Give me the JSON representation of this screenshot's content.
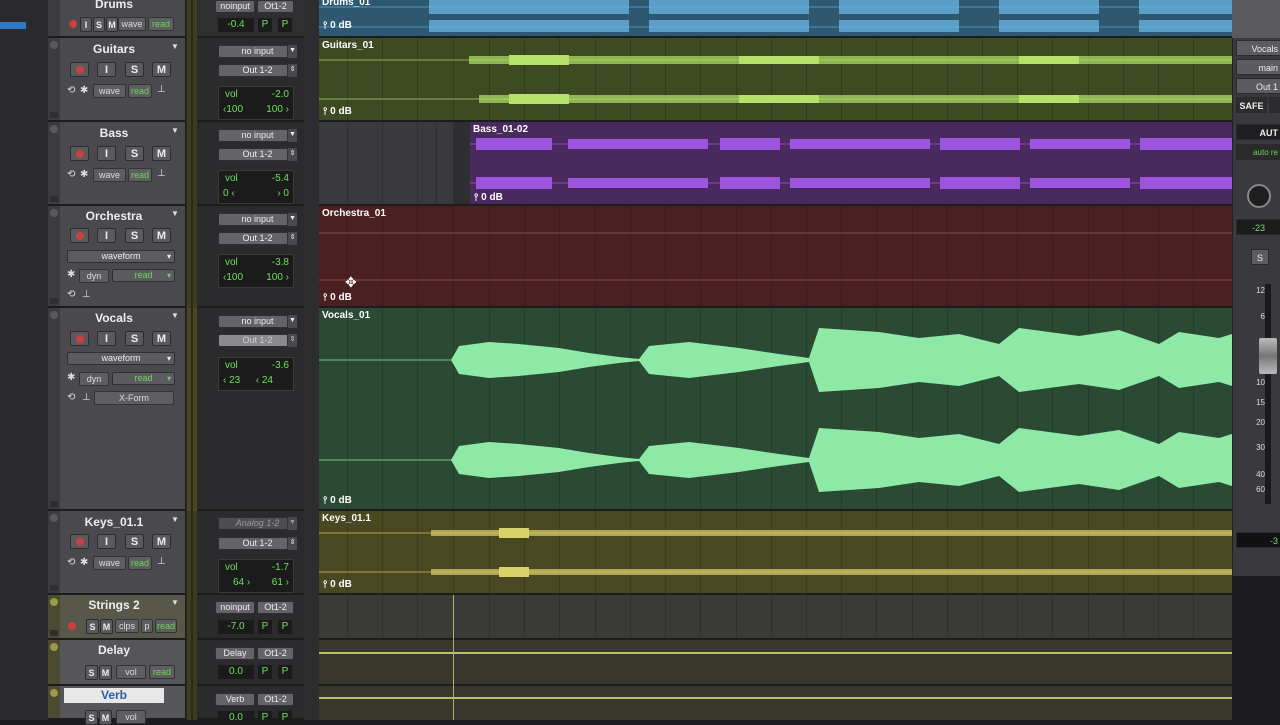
{
  "tracks": {
    "drums": {
      "name": "Drums",
      "input": "noinput",
      "output": "Ot1-2",
      "vol": "-0.4",
      "p1": "P",
      "p2": "P",
      "clip": "Drums_01",
      "gain": "0 dB",
      "view": "wave",
      "auto": "read"
    },
    "guitars": {
      "name": "Guitars",
      "input": "no input",
      "output": "Out 1-2",
      "vol_label": "vol",
      "vol": "-2.0",
      "pan_l": "‹100",
      "pan_r": "100 ›",
      "clip": "Guitars_01",
      "gain": "0 dB",
      "view": "wave",
      "auto": "read"
    },
    "bass": {
      "name": "Bass",
      "input": "no input",
      "output": "Out 1-2",
      "vol_label": "vol",
      "vol": "-5.4",
      "pan_l": "0 ‹",
      "pan_r": "› 0",
      "clip": "Bass_01-02",
      "gain": "0 dB",
      "view": "wave",
      "auto": "read"
    },
    "orchestra": {
      "name": "Orchestra",
      "input": "no input",
      "output": "Out 1-2",
      "vol_label": "vol",
      "vol": "-3.8",
      "pan_l": "‹100",
      "pan_r": "100 ›",
      "clip": "Orchestra_01",
      "gain": "0 dB",
      "view": "waveform",
      "dyn": "dyn",
      "auto": "read"
    },
    "vocals": {
      "name": "Vocals",
      "input": "no input",
      "output": "Out 1-2",
      "vol_label": "vol",
      "vol": "-3.6",
      "pan_l": "‹ 23",
      "pan_r": "‹ 24",
      "clip": "Vocals_01",
      "gain": "0 dB",
      "view": "waveform",
      "dyn": "dyn",
      "auto": "read",
      "plugin": "X-Form"
    },
    "keys": {
      "name": "Keys_01.1",
      "input": "Analog 1-2",
      "output": "Out 1-2",
      "vol_label": "vol",
      "vol": "-1.7",
      "pan_l": "64 ›",
      "pan_r": "61 ›",
      "clip": "Keys_01.1",
      "gain": "0 dB",
      "view": "wave",
      "auto": "read"
    },
    "strings": {
      "name": "Strings 2",
      "input": "noinput",
      "output": "Ot1-2",
      "vol": "-7.0",
      "p1": "P",
      "p2": "P",
      "view": "clps",
      "auto": "read",
      "p": "p"
    },
    "delay": {
      "name": "Delay",
      "input": "Delay",
      "output": "Ot1-2",
      "vol": "0.0",
      "p1": "P",
      "p2": "P",
      "view": "vol",
      "auto": "read"
    },
    "verb": {
      "name": "Verb",
      "input": "Verb",
      "output": "Ot1-2",
      "vol": "0.0",
      "p1": "P",
      "p2": "P",
      "view": "vol"
    }
  },
  "buttons": {
    "input": "I",
    "solo": "S",
    "mute": "M"
  },
  "inspector": {
    "track": "Vocals",
    "group": "main",
    "out": "Out 1",
    "safe": "SAFE",
    "auto": "AUT",
    "auto_mode": "auto re",
    "knob_val": "-23",
    "solo": "S",
    "scale": [
      "12",
      "6",
      "0",
      "5",
      "10",
      "15",
      "20",
      "30",
      "40",
      "60"
    ],
    "bottom_val": "-3"
  },
  "colors": {
    "drums": "#5fa8d8",
    "guitars": "#a8d65a",
    "bass": "#9a4fd6",
    "orchestra": "#5a2424",
    "vocals": "#7fe59a",
    "keys": "#c8c45a"
  }
}
